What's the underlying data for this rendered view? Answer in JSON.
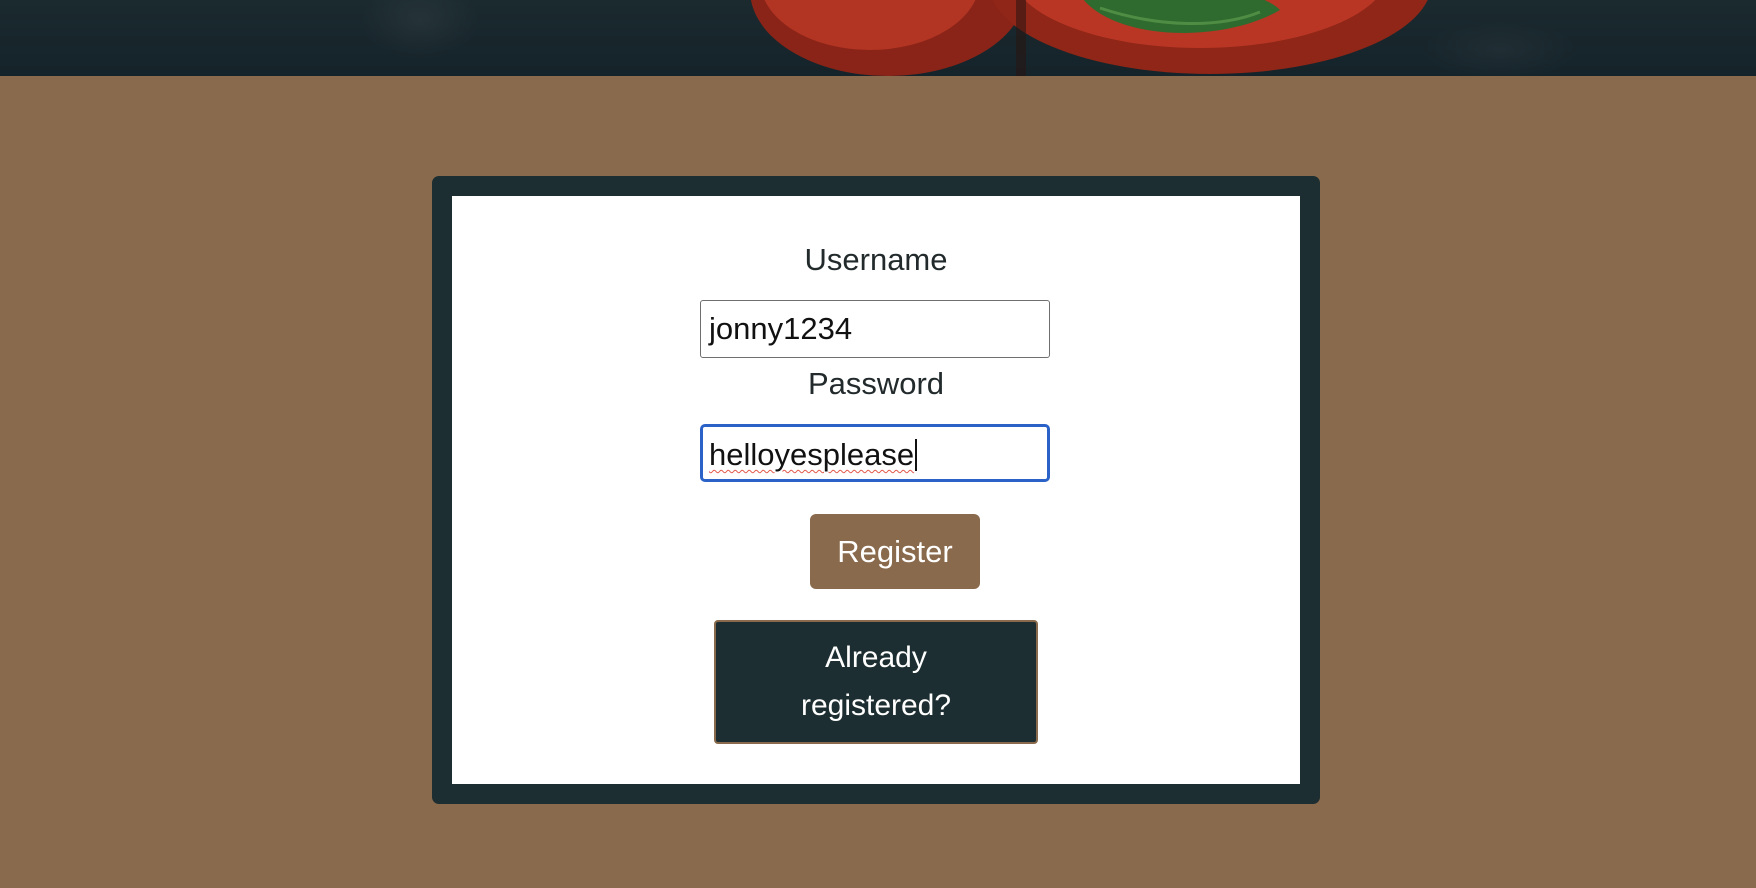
{
  "form": {
    "username_label": "Username",
    "username_value": "jonny1234",
    "password_label": "Password",
    "password_value": "helloyesplease",
    "register_label": "Register",
    "already_registered_label": "Already registered?"
  },
  "colors": {
    "page_background": "#8a6a4c",
    "card_border": "#1c2e31",
    "register_button": "#8a6a4c",
    "already_registered_button": "#1c2e31",
    "focus_ring": "#2a62c8"
  },
  "icons": {
    "hero": "tomatoes-photo"
  }
}
